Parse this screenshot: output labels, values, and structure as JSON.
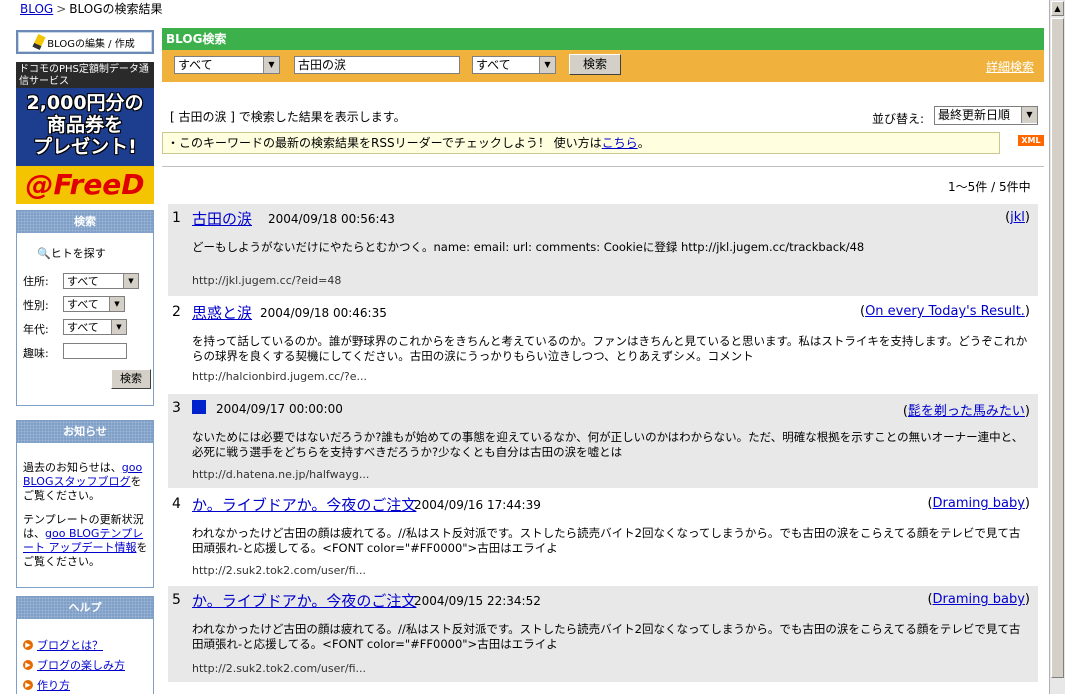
{
  "breadcrumb": {
    "home": "BLOG",
    "sep": ">",
    "current": "BLOGの検索結果"
  },
  "sidebar": {
    "edit_button": "BLOGの編集 / 作成",
    "ad": {
      "head": "ドコモのPHS定額制データ通信サービス",
      "main_line1": "2,000円分の",
      "main_line2": "商品券を",
      "main_line3": "プレゼント!",
      "logo": "@FreeD"
    },
    "search_panel": {
      "title": "検索",
      "people_search": "ヒトを探す",
      "address_label": "住所:",
      "address_value": "すべて",
      "gender_label": "性別:",
      "gender_value": "すべて",
      "age_label": "年代:",
      "age_value": "すべて",
      "hobby_label": "趣味:",
      "button": "検索"
    },
    "notice_panel": {
      "title": "お知らせ",
      "p1_text": "過去のお知らせは、",
      "p1_link": "goo BLOGスタッフブログ",
      "p1_end": "をご覧ください。",
      "p2_text": "テンプレートの更新状況は、",
      "p2_link": "goo BLOGテンプレート アップデート情報",
      "p2_end": "をご覧ください。"
    },
    "help_panel": {
      "title": "ヘルプ",
      "items": [
        "ブログとは？",
        "ブログの楽しみ方",
        "作り方"
      ]
    }
  },
  "header": {
    "title": "BLOG検索",
    "scope_select": "すべて",
    "keyword": "古田の涙",
    "field_select": "すべて",
    "search_button": "検索",
    "advanced_link": "詳細検索"
  },
  "results_meta": {
    "message": "[ 古田の涙 ] で検索した結果を表示します。",
    "sort_label": "並び替え:",
    "sort_value": "最終更新日順",
    "rss_text": "・このキーワードの最新の検索結果をRSSリーダーでチェックしよう！ 使い方は",
    "rss_link": "こちら",
    "rss_end": "。",
    "xml_icon": "XML",
    "count": "1～5件 / 5件中"
  },
  "results": [
    {
      "num": "1",
      "title": "古田の涙",
      "date": "2004/09/18 00:56:43",
      "author": "jkl",
      "snippet": "どーもしようがないだけにやたらとむかつく。name: email: url: comments: Cookieに登録 http://jkl.jugem.cc/trackback/48",
      "url": "http://jkl.jugem.cc/?eid=48"
    },
    {
      "num": "2",
      "title": "思惑と涙",
      "date": "2004/09/18 00:46:35",
      "author": "On every Today's Result.",
      "snippet": "を持って話しているのか。誰が野球界のこれからをきちんと考えているのか。ファンはきちんと見ていると思います。私はストライキを支持します。どうぞこれからの球界を良くする契機にしてください。古田の涙にうっかりもらい泣きしつつ、とりあえずシメ。コメント",
      "url": "http://halcionbird.jugem.cc/?e..."
    },
    {
      "num": "3",
      "title": "",
      "date": "2004/09/17 00:00:00",
      "author": "髭を剃った馬みたい",
      "snippet": "ないためには必要ではないだろうか?誰もが始めての事態を迎えているなか、何が正しいのかはわからない。ただ、明確な根拠を示すことの無いオーナー連中と、必死に戦う選手をどちらを支持すべきだろうか?少なくとも自分は古田の涙を嘘とは",
      "url": "http://d.hatena.ne.jp/halfwayg..."
    },
    {
      "num": "4",
      "title": "か。ライブドアか。今夜のご注文",
      "date": "2004/09/16 17:44:39",
      "author": "Draming baby",
      "snippet": "われなかったけど古田の顔は疲れてる。//私はスト反対派です。ストしたら読売バイト2回なくなってしまうから。でも古田の涙をこらえてる顔をテレビで見て古田頑張れ-と応援してる。<FONT color=\"#FF0000\">古田はエライよ",
      "url": "http://2.suk2.tok2.com/user/fi..."
    },
    {
      "num": "5",
      "title": "か。ライブドアか。今夜のご注文",
      "date": "2004/09/15 22:34:52",
      "author": "Draming baby",
      "snippet": "われなかったけど古田の顔は疲れてる。//私はスト反対派です。ストしたら読売バイト2回なくなってしまうから。でも古田の涙をこらえてる顔をテレビで見て古田頑張れ-と応援してる。<FONT color=\"#FF0000\">古田はエライよ",
      "url": "http://2.suk2.tok2.com/user/fi..."
    }
  ]
}
